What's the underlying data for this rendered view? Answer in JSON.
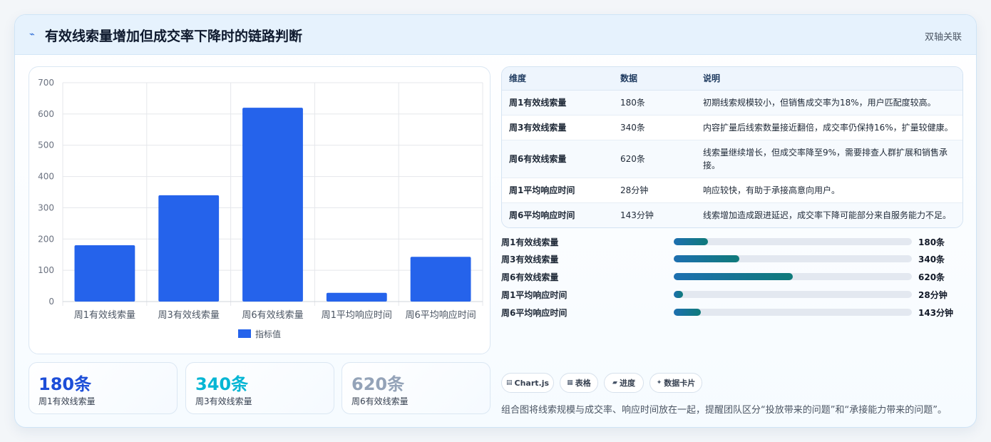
{
  "header": {
    "icon": "chart-icon",
    "title": "有效线索量增加但成交率下降时的链路判断",
    "tag": "双轴关联"
  },
  "chart_data": {
    "type": "bar",
    "categories": [
      "周1有效线索量",
      "周3有效线索量",
      "周6有效线索量",
      "周1平均响应时间",
      "周6平均响应时间"
    ],
    "series": [
      {
        "name": "指标值",
        "values": [
          180,
          340,
          620,
          28,
          143
        ],
        "color": "#2563eb"
      }
    ],
    "ylim": [
      0,
      700
    ],
    "yticks": [
      0,
      100,
      200,
      300,
      400,
      500,
      600,
      700
    ],
    "grid": true,
    "legend": "bottom"
  },
  "stats": [
    {
      "value": "180条",
      "label": "周1有效线索量",
      "color": "#1d4ed8"
    },
    {
      "value": "340条",
      "label": "周3有效线索量",
      "color": "#06b6d4"
    },
    {
      "value": "620条",
      "label": "周6有效线索量",
      "color": "#94a3b8"
    }
  ],
  "table": {
    "headers": [
      "维度",
      "数据",
      "说明"
    ],
    "rows": [
      [
        "周1有效线索量",
        "180条",
        "初期线索规模较小，但销售成交率为18%，用户匹配度较高。"
      ],
      [
        "周3有效线索量",
        "340条",
        "内容扩量后线索数量接近翻倍，成交率仍保持16%，扩量较健康。"
      ],
      [
        "周6有效线索量",
        "620条",
        "线索量继续增长，但成交率降至9%，需要排查人群扩展和销售承接。"
      ],
      [
        "周1平均响应时间",
        "28分钟",
        "响应较快，有助于承接高意向用户。"
      ],
      [
        "周6平均响应时间",
        "143分钟",
        "线索增加造成跟进延迟，成交率下降可能部分来自服务能力不足。"
      ]
    ]
  },
  "progress": [
    {
      "label": "周1有效线索量",
      "value": "180条",
      "fraction": 0.145
    },
    {
      "label": "周3有效线索量",
      "value": "340条",
      "fraction": 0.274
    },
    {
      "label": "周6有效线索量",
      "value": "620条",
      "fraction": 0.5
    },
    {
      "label": "周1平均响应时间",
      "value": "28分钟",
      "fraction": 0.04
    },
    {
      "label": "周6平均响应时间",
      "value": "143分钟",
      "fraction": 0.115
    }
  ],
  "chips": [
    {
      "icon": "▤",
      "label": "Chart.js"
    },
    {
      "icon": "▦",
      "label": "表格"
    },
    {
      "icon": "▰",
      "label": "进度"
    },
    {
      "icon": "✦",
      "label": "数据卡片"
    }
  ],
  "note": "组合图将线索规模与成交率、响应时间放在一起，提醒团队区分“投放带来的问题”和“承接能力带来的问题”。"
}
